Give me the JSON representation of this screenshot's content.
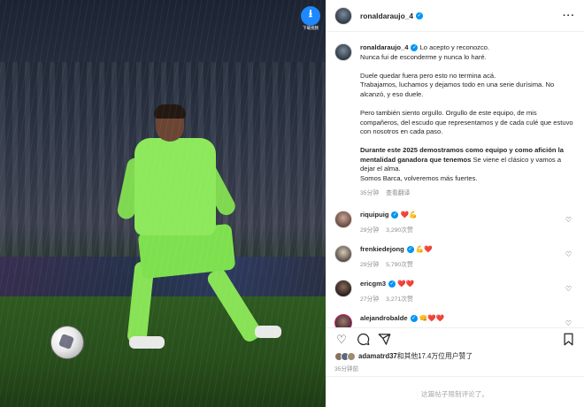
{
  "download_button": {
    "label": "下载视频",
    "icon": "download-icon"
  },
  "post": {
    "username": "ronaldaraujo_4",
    "more_icon": "more-horizontal-icon"
  },
  "caption": {
    "first_line": "Lo acepto y reconozco.",
    "lines": [
      "Nunca fui de esconderme y nunca lo haré.",
      "Duele quedar fuera pero esto no termina acá.",
      "Trabajamos, luchamos y dejamos todo en una serie durísima. No alcanzó, y eso duele.",
      "Pero también siento orgullo. Orgullo de este equipo, de mis compañeros, del escudo que representamos y de cada culé que estuvo con nosotros en cada paso."
    ],
    "bold_part": "Durante este 2025 demostramos como equipo y como afición la mentalidad ganadora que tenemos",
    "after_bold": " Se viene el clásico y vamos a dejar el alma.",
    "final_line": "Somos Barca, volveremos más fuertes.",
    "time": "35分钟",
    "translate": "查看翻译"
  },
  "comments": [
    {
      "username": "riquipuig",
      "emojis": "❤️💪",
      "time": "29分钟",
      "likes": "3,290次赞"
    },
    {
      "username": "frenkiedejong",
      "emojis": "💪❤️",
      "time": "29分钟",
      "likes": "5,790次赞"
    },
    {
      "username": "ericgm3",
      "emojis": "❤️❤️",
      "time": "27分钟",
      "likes": "3,271次赞"
    },
    {
      "username": "alejandrobalde",
      "emojis": "👊❤️❤️",
      "time": "",
      "likes": ""
    }
  ],
  "actions": {
    "like_icon": "heart-icon",
    "comment_icon": "comment-icon",
    "share_icon": "send-icon",
    "save_icon": "bookmark-icon"
  },
  "likes_line": {
    "user": "adamatrd37",
    "rest": "和其他17.4万位用户赞了"
  },
  "post_time": "35分钟前",
  "restricted_text": "这篇帖子限制评论了。"
}
